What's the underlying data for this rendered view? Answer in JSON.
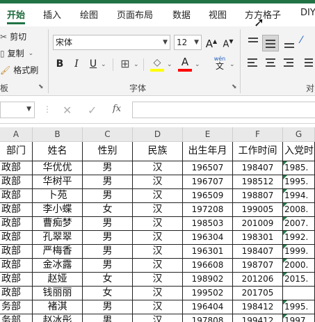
{
  "tabs": [
    "开始",
    "插入",
    "绘图",
    "页面布局",
    "数据",
    "视图",
    "方方格子",
    "DIY"
  ],
  "clipboard": {
    "cut": "剪切",
    "copy": "复制",
    "format_painter": "格式刷",
    "group": "板"
  },
  "font": {
    "name": "宋体",
    "size": "12",
    "grow": "A",
    "shrink": "A",
    "bold": "B",
    "italic": "I",
    "underline": "U",
    "phonetic_top": "wén",
    "phonetic_bottom": "文",
    "fill_icon_letter": "◇",
    "font_color_letter": "A",
    "group": "字体"
  },
  "alignment": {
    "group": "对"
  },
  "formula_bar": {
    "cancel": "✕",
    "enter": "✓",
    "fx": "fx",
    "value": ""
  },
  "columns": [
    "A",
    "B",
    "C",
    "D",
    "E",
    "F",
    "G"
  ],
  "headers": [
    "部门",
    "姓名",
    "性别",
    "民族",
    "出生年月",
    "工作时间",
    "入党时"
  ],
  "rows": [
    [
      "政部",
      "华优优",
      "男",
      "汉",
      "196507",
      "198407",
      "1985."
    ],
    [
      "政部",
      "华树平",
      "男",
      "汉",
      "196707",
      "198512",
      "1995."
    ],
    [
      "政部",
      "卜苑",
      "男",
      "汉",
      "196509",
      "198807",
      "1994."
    ],
    [
      "政部",
      "李小蝶",
      "女",
      "汉",
      "197208",
      "199005",
      "2008."
    ],
    [
      "政部",
      "曹痴梦",
      "男",
      "汉",
      "198503",
      "201009",
      "2007."
    ],
    [
      "政部",
      "孔翠翠",
      "男",
      "汉",
      "196304",
      "198301",
      "1992."
    ],
    [
      "政部",
      "严梅香",
      "男",
      "汉",
      "196301",
      "198407",
      "1999."
    ],
    [
      "政部",
      "金冰露",
      "男",
      "汉",
      "196608",
      "198707",
      "2000."
    ],
    [
      "政部",
      "赵娅",
      "女",
      "汉",
      "198902",
      "201206",
      "2015."
    ],
    [
      "政部",
      "钱丽丽",
      "女",
      "汉",
      "199502",
      "201705",
      ""
    ],
    [
      "务部",
      "褚淇",
      "男",
      "汉",
      "196404",
      "198412",
      "1995."
    ],
    [
      "务部",
      "赵冰彤",
      "男",
      "汉",
      "197808",
      "199412",
      "1997."
    ]
  ],
  "colors": {
    "accent": "#217346",
    "fill_bar": "#ffff00",
    "font_bar": "#ff0000",
    "error_triangle": "#1e7e45"
  }
}
